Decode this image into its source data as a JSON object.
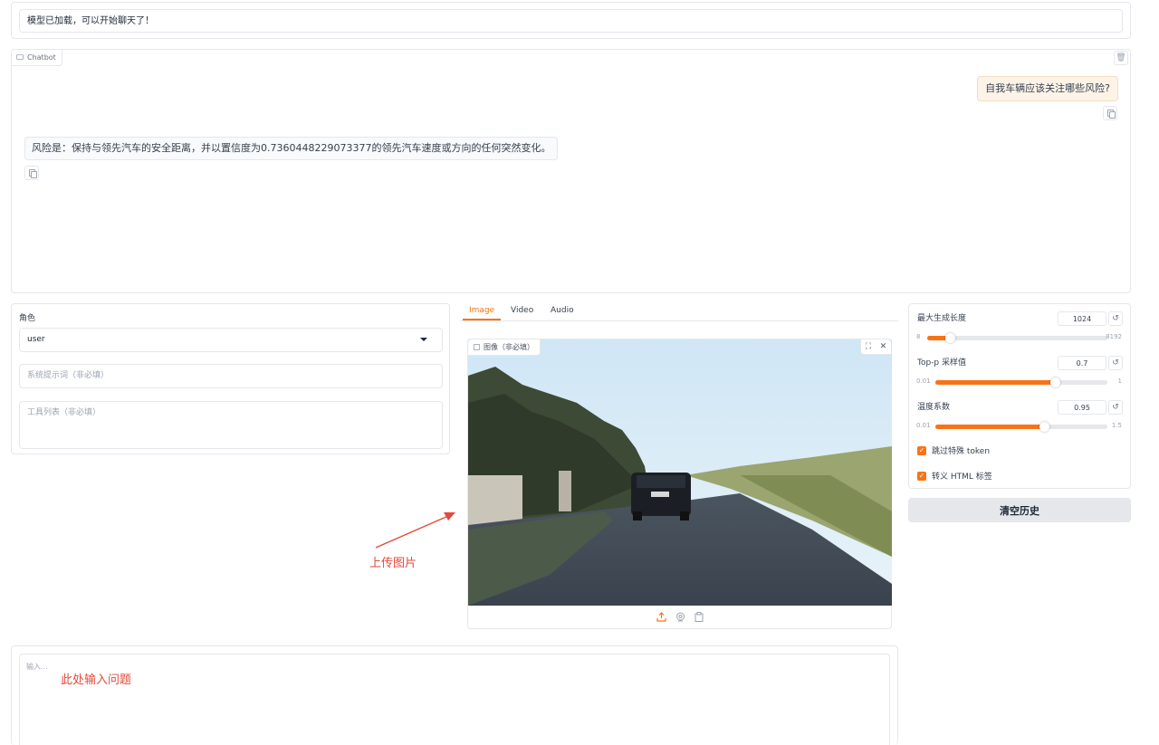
{
  "status": {
    "text": "模型已加载，可以开始聊天了！"
  },
  "chatbot": {
    "label": "Chatbot",
    "messages": [
      {
        "role": "user",
        "text": "自我车辆应该关注哪些风险?"
      },
      {
        "role": "bot",
        "text": "风险是：保持与领先汽车的安全距离，并以置信度为0.7360448229073377的领先汽车速度或方向的任何突然变化。"
      }
    ]
  },
  "role": {
    "label": "角色",
    "value": "user"
  },
  "system_prompt": {
    "placeholder": "系统提示词（非必填）"
  },
  "tools_list": {
    "placeholder": "工具列表（非必填）"
  },
  "media_tabs": {
    "image": "Image",
    "video": "Video",
    "audio": "Audio",
    "active": "Image"
  },
  "image_input": {
    "label": "图像（非必填）"
  },
  "params": {
    "max_length": {
      "label": "最大生成长度",
      "value": "1024",
      "min": "8",
      "max": "8192",
      "fraction": 0.124
    },
    "top_p": {
      "label": "Top-p 采样值",
      "value": "0.7",
      "min": "0.01",
      "max": "1",
      "fraction": 0.697
    },
    "temperature": {
      "label": "温度系数",
      "value": "0.95",
      "min": "0.01",
      "max": "1.5",
      "fraction": 0.631
    }
  },
  "options": {
    "skip_special": {
      "label": "跳过特殊 token",
      "checked": true
    },
    "escape_html": {
      "label": "转义 HTML 标签",
      "checked": true
    }
  },
  "clear_button": "清空历史",
  "annotations": {
    "upload": "上传图片",
    "question": "此处输入问题"
  },
  "question_input": {
    "placeholder": "输入..."
  },
  "colors": {
    "accent": "#f97316",
    "annotation": "#e24a3b",
    "user_bubble": "#fdf3e7"
  }
}
